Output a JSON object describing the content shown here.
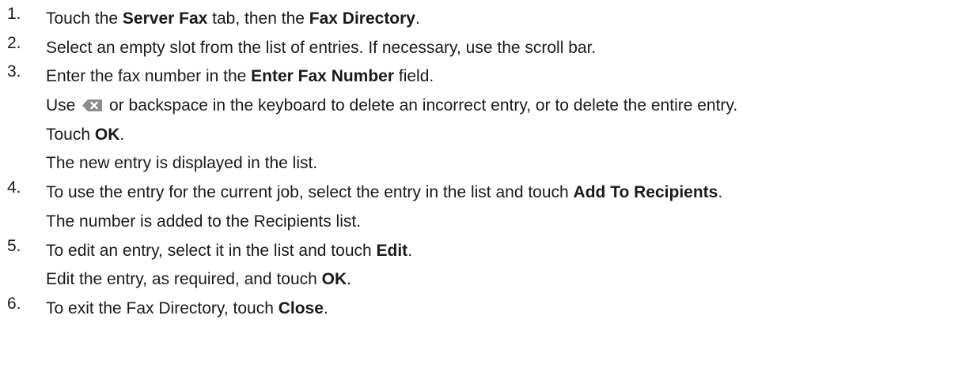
{
  "steps": [
    {
      "number": "1.",
      "lines": [
        [
          "Touch the ",
          "Server Fax",
          " tab, then the ",
          "Fax Directory",
          "."
        ]
      ]
    },
    {
      "number": "2.",
      "lines": [
        [
          "Select an empty slot from the list of entries. If necessary, use the scroll bar."
        ]
      ]
    },
    {
      "number": "3.",
      "lines": [
        [
          "Enter the fax number in the ",
          "Enter Fax Number",
          " field."
        ],
        [
          "Use ",
          " or backspace in the keyboard to delete an incorrect entry, or to delete the entire entry."
        ],
        [
          "Touch ",
          "OK",
          "."
        ],
        [
          "The new entry is displayed in the list."
        ]
      ]
    },
    {
      "number": "4.",
      "lines": [
        [
          "To use the entry for the current job, select the entry in the list and touch ",
          "Add To Recipients",
          "."
        ],
        [
          "The number is added to the Recipients list."
        ]
      ]
    },
    {
      "number": "5.",
      "lines": [
        [
          "To edit an entry, select it in the list and touch ",
          "Edit",
          "."
        ],
        [
          "Edit the entry, as required, and touch ",
          "OK",
          "."
        ]
      ]
    },
    {
      "number": "6.",
      "lines": [
        [
          "To exit the Fax Directory, touch ",
          "Close",
          "."
        ]
      ]
    }
  ],
  "icons": {
    "backspace_icon": "backspace-key",
    "icon_color": "#8c8c8c"
  }
}
